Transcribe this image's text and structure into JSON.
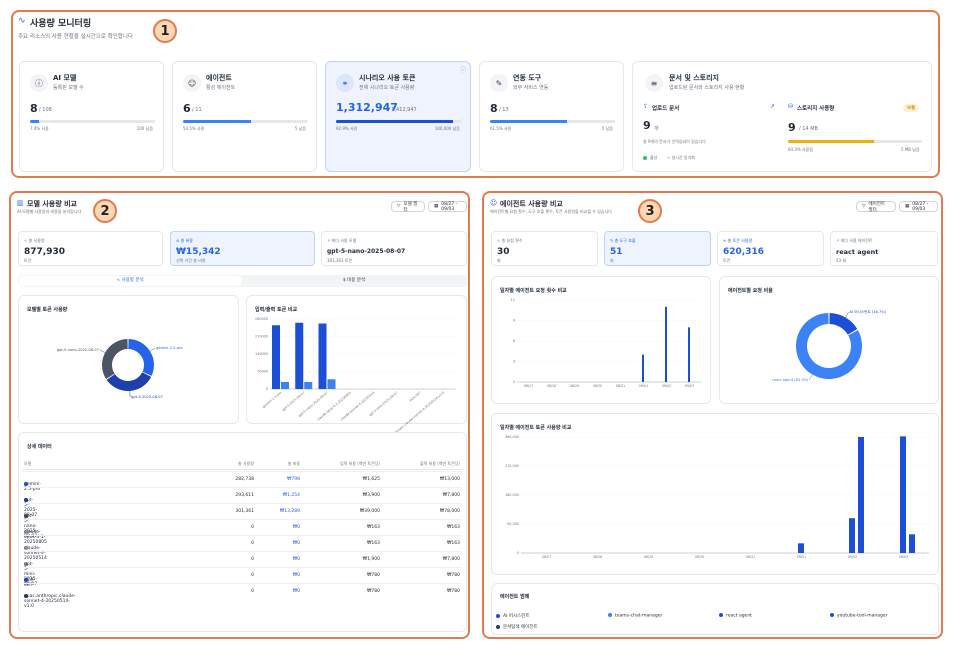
{
  "header": {
    "title": "사용량 모니터링",
    "subtitle": "주요 리소스의 사용 현황을 실시간으로 확인합니다"
  },
  "badges": [
    "1",
    "2",
    "3"
  ],
  "summary": [
    {
      "title": "AI 모델",
      "sub": "등록된 모델 수",
      "value": "8",
      "total": "/ 108",
      "left": "7.4% 사용",
      "right": "100 남음",
      "pct": 0.074
    },
    {
      "title": "에이전트",
      "sub": "활성 에이전트",
      "value": "6",
      "total": "/ 11",
      "left": "54.5% 사용",
      "right": "5 남음",
      "pct": 0.545
    },
    {
      "title": "시나리오 사용 토큰",
      "sub": "전체 시나리오 토큰 사용량",
      "value": "1,312,947",
      "total": "/ 1,412,947",
      "left": "92.9% 사용",
      "right": "100,000 남음",
      "pct": 0.929
    },
    {
      "title": "연동 도구",
      "sub": "외부 서비스 연동",
      "value": "8",
      "total": "/ 13",
      "left": "61.5% 사용",
      "right": "5 남음",
      "pct": 0.615
    }
  ],
  "storage": {
    "title": "문서 및 스토리지",
    "sub": "업로드된 문서와 스토리지 사용 현황",
    "upload_title": "업로드 문서",
    "upload_value": "9",
    "upload_unit": "개",
    "upload_note": "총 9개의 문서가 인덱싱되어 있습니다",
    "active": "활성",
    "sync": "실시간 동기화",
    "storage_title": "스토리지 사용량",
    "status": "보통",
    "storage_value": "9",
    "storage_unit": "/ 14 MB",
    "storage_left": "64.3% 사용됨",
    "storage_right": "5 MB 남음",
    "pct": 0.643
  },
  "model": {
    "title": "모델 사용량 비교",
    "subtitle": "AI 모델별 사용량과 비용을 분석합니다",
    "filter": "모델 필터",
    "date": "08/27 - 09/03",
    "stats": [
      {
        "label": "총 사용량",
        "value": "877,930",
        "unit": "토큰"
      },
      {
        "label": "총 비용",
        "value": "₩15,342",
        "unit": "선택 기간 총 비용"
      },
      {
        "label": "최다 사용 모델",
        "value": "gpt-5-nano-2025-08-07",
        "unit": "301,361 토큰"
      }
    ],
    "tab1": "사용량 분석",
    "tab2": "비용 분석",
    "donut_title": "모델별 토큰 사용량",
    "bar_title": "입력/출력 토큰 비교",
    "table_title": "상세 데이터",
    "headers": [
      "모델",
      "총 사용량",
      "총 비용",
      "입력 비용 (백만 토큰당)",
      "출력 비용 (백만 토큰당)"
    ],
    "rows": [
      [
        "gemini-2.5-pro",
        "282,738",
        "₩798",
        "₩1,625",
        "₩13,000"
      ],
      [
        "gpt-5-2025-08-07",
        "293,611",
        "₩1,254",
        "₩3,900",
        "₩7,800"
      ],
      [
        "gpt-5-nano-2025-08-07",
        "301,361",
        "₩13,289",
        "₩39,000",
        "₩78,000"
      ],
      [
        "claude-opus-4-1-20250805",
        "0",
        "₩0",
        "₩163",
        "₩163"
      ],
      [
        "claude-sonnet-4-20250514",
        "0",
        "₩0",
        "₩163",
        "₩163"
      ],
      [
        "gpt-5-mini-2025-08-07",
        "0",
        "₩0",
        "₩1,900",
        "₩7,800"
      ],
      [
        "HCX-007",
        "0",
        "₩0",
        "₩780",
        "₩780"
      ],
      [
        "apac.anthropic.claude-sonnet-4-20250514-v1:0",
        "0",
        "₩0",
        "₩780",
        "₩780"
      ]
    ],
    "row_colors": [
      "#2563eb",
      "#1e40af",
      "#4b5563",
      "#9ca3af",
      "#9ca3af",
      "#9ca3af",
      "#1d4ed8",
      "#1e3a8a"
    ]
  },
  "agent": {
    "title": "에이전트 사용량 비교",
    "subtitle": "에이전트별 요청 횟수, 도구 호출 횟수, 토큰 사용량을 비교할 수 있습니다",
    "filter": "에이전트 필터",
    "date": "08/27 - 09/03",
    "stats": [
      {
        "label": "총 요청 횟수",
        "value": "30",
        "unit": "회"
      },
      {
        "label": "총 도구 호출",
        "value": "51",
        "unit": "회"
      },
      {
        "label": "총 토큰 사용량",
        "value": "620,316",
        "unit": "토큰"
      },
      {
        "label": "최다 사용 에이전트",
        "value": "react agent",
        "unit": "23 회"
      }
    ],
    "req_title": "일자별 에이전트 요청 횟수 비교",
    "pie_title": "에이전트별 요청 비율",
    "tok_title": "일자별 에이전트 토큰 사용량 비교",
    "legend_title": "에이전트 범례",
    "legend": [
      {
        "name": "AI 어시스턴트",
        "color": "#1d4ed8"
      },
      {
        "name": "teams-chat-manager",
        "color": "#3b82f6"
      },
      {
        "name": "react agent",
        "color": "#1d4ed8"
      },
      {
        "name": "youtube-tool-manager",
        "color": "#1d4ed8"
      },
      {
        "name": "문서탐색 에이전트",
        "color": "#1e3a8a"
      }
    ]
  },
  "chart_data": [
    {
      "type": "pie",
      "title": "모델별 토큰 사용량",
      "labels": [
        "gemini-2.5-pro",
        "gpt-5-2025-08-07",
        "gpt-5-nano-2025-08-07"
      ],
      "values": [
        282738,
        293611,
        301361
      ],
      "colors": [
        "#2563eb",
        "#1e40af",
        "#4b5563"
      ]
    },
    {
      "type": "bar",
      "title": "입력/출력 토큰 비교",
      "categories": [
        "gemini-2.5-pro",
        "gpt-5-2025-08-07",
        "gpt-5-nano-2025-08-07",
        "claude-opus-4-1-20250805",
        "claude-sonnet-4-20250514",
        "gpt-5-mini-2025-08-07",
        "HCX-007",
        "apac.anthropic.claude-sonnet-4-20250514-v1:0"
      ],
      "series": [
        {
          "values": [
            255000,
            265000,
            262000,
            0,
            0,
            0,
            0,
            0
          ]
        },
        {
          "values": [
            28000,
            28000,
            39000,
            0,
            0,
            0,
            0,
            0
          ]
        }
      ],
      "yticks": [
        "0",
        "70000",
        "140000",
        "210000",
        "280000"
      ],
      "ylim": [
        0,
        280000
      ]
    },
    {
      "type": "bar",
      "title": "일자별 에이전트 요청 횟수 비교",
      "categories": [
        "08/27",
        "08/28",
        "08/29",
        "08/30",
        "08/31",
        "09/01",
        "09/02",
        "09/03"
      ],
      "values": [
        0,
        0,
        0,
        0,
        0,
        4,
        11,
        8
      ],
      "yticks": [
        "0",
        "3",
        "6",
        "9",
        "12"
      ],
      "ylim": [
        0,
        12
      ]
    },
    {
      "type": "pie",
      "title": "에이전트별 요청 비율",
      "labels": [
        "AI 어시스턴트 (16.7%)",
        "react agent (83.3%)"
      ],
      "values": [
        16.7,
        83.3
      ],
      "colors": [
        "#1d4ed8",
        "#3b82f6"
      ]
    },
    {
      "type": "bar",
      "title": "일자별 에이전트 토큰 사용량 비교",
      "categories": [
        "08/27",
        "08/28",
        "08/29",
        "08/30",
        "08/31",
        "09/01",
        "09/02",
        "09/03"
      ],
      "values": [
        0,
        0,
        0,
        0,
        0,
        30000,
        108000,
        362000,
        58000
      ],
      "yticks": [
        "0",
        "90,000",
        "180,000",
        "270,000",
        "360,000"
      ],
      "ylim": [
        0,
        360000
      ]
    }
  ]
}
